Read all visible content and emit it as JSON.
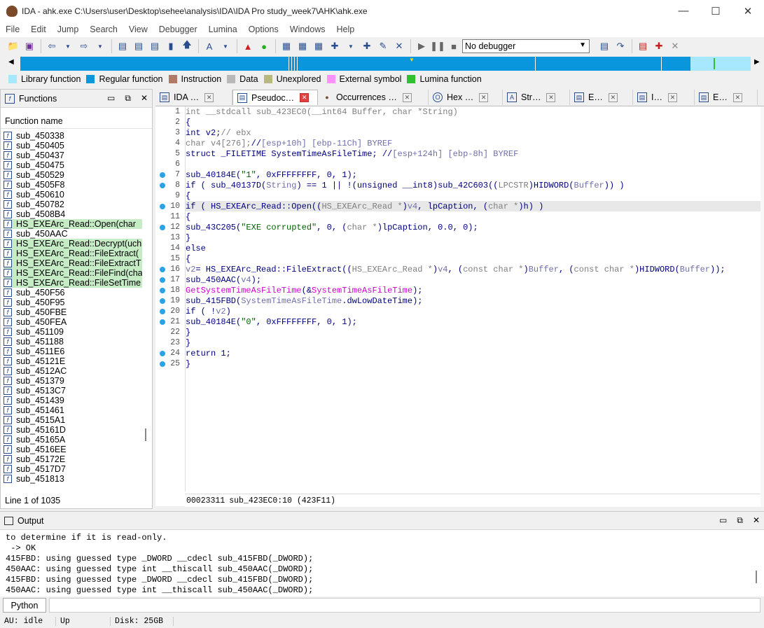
{
  "window": {
    "title": "IDA - ahk.exe C:\\Users\\user\\Desktop\\sehee\\analysis\\IDA\\IDA Pro study_week7\\AHK\\ahk.exe"
  },
  "menu": [
    "File",
    "Edit",
    "Jump",
    "Search",
    "View",
    "Debugger",
    "Lumina",
    "Options",
    "Windows",
    "Help"
  ],
  "toolbar": {
    "debugger_select": "No debugger"
  },
  "legend": [
    {
      "label": "Library function",
      "color": "#a8e8ff"
    },
    {
      "label": "Regular function",
      "color": "#0a96dc"
    },
    {
      "label": "Instruction",
      "color": "#b07a66"
    },
    {
      "label": "Data",
      "color": "#b8b8b8"
    },
    {
      "label": "Unexplored",
      "color": "#b8b880"
    },
    {
      "label": "External symbol",
      "color": "#ff90ff"
    },
    {
      "label": "Lumina function",
      "color": "#30c030"
    }
  ],
  "functions_panel": {
    "title": "Functions",
    "column": "Function name",
    "items": [
      {
        "name": "sub_450338",
        "lumina": false
      },
      {
        "name": "sub_450405",
        "lumina": false
      },
      {
        "name": "sub_450437",
        "lumina": false
      },
      {
        "name": "sub_450475",
        "lumina": false
      },
      {
        "name": "sub_450529",
        "lumina": false
      },
      {
        "name": "sub_4505F8",
        "lumina": false
      },
      {
        "name": "sub_450610",
        "lumina": false
      },
      {
        "name": "sub_450782",
        "lumina": false
      },
      {
        "name": "sub_4508B4",
        "lumina": false
      },
      {
        "name": "HS_EXEArc_Read::Open(char",
        "lumina": true
      },
      {
        "name": "sub_450AAC",
        "lumina": false
      },
      {
        "name": "HS_EXEArc_Read::Decrypt(uch",
        "lumina": true
      },
      {
        "name": "HS_EXEArc_Read::FileExtract(",
        "lumina": true
      },
      {
        "name": "HS_EXEArc_Read::FileExtractT",
        "lumina": true
      },
      {
        "name": "HS_EXEArc_Read::FileFind(cha",
        "lumina": true
      },
      {
        "name": "HS_EXEArc_Read::FileSetTime",
        "lumina": true
      },
      {
        "name": "sub_450F56",
        "lumina": false
      },
      {
        "name": "sub_450F95",
        "lumina": false
      },
      {
        "name": "sub_450FBE",
        "lumina": false
      },
      {
        "name": "sub_450FEA",
        "lumina": false
      },
      {
        "name": "sub_451109",
        "lumina": false
      },
      {
        "name": "sub_451188",
        "lumina": false
      },
      {
        "name": "sub_4511E6",
        "lumina": false
      },
      {
        "name": "sub_45121E",
        "lumina": false
      },
      {
        "name": "sub_4512AC",
        "lumina": false
      },
      {
        "name": "sub_451379",
        "lumina": false
      },
      {
        "name": "sub_4513C7",
        "lumina": false
      },
      {
        "name": "sub_451439",
        "lumina": false
      },
      {
        "name": "sub_451461",
        "lumina": false
      },
      {
        "name": "sub_4515A1",
        "lumina": false
      },
      {
        "name": "sub_45161D",
        "lumina": false
      },
      {
        "name": "sub_45165A",
        "lumina": false
      },
      {
        "name": "sub_4516EE",
        "lumina": false
      },
      {
        "name": "sub_45172E",
        "lumina": false
      },
      {
        "name": "sub_4517D7",
        "lumina": false
      },
      {
        "name": "sub_451813",
        "lumina": false
      }
    ],
    "status": "Line 1 of 1035"
  },
  "tabs": [
    {
      "label": "IDA …",
      "active": false
    },
    {
      "label": "Pseudoc…",
      "active": true
    },
    {
      "label": "Occurrences …",
      "active": false
    },
    {
      "label": "Hex …",
      "active": false
    },
    {
      "label": "Str…",
      "active": false
    },
    {
      "label": "E…",
      "active": false
    },
    {
      "label": "I…",
      "active": false
    },
    {
      "label": "E…",
      "active": false
    }
  ],
  "code": {
    "lines": [
      {
        "n": "1",
        "dot": false,
        "hl": false,
        "html": "<span class='g'>int __stdcall sub_423EC0(__int64 Buffer, char *String)</span>"
      },
      {
        "n": "2",
        "dot": false,
        "hl": false,
        "html": "<span class='k'>{</span>"
      },
      {
        "n": "3",
        "dot": false,
        "hl": false,
        "html": "  <span class='k'>int v2;</span> <span class='g'>// ebx</span>"
      },
      {
        "n": "4",
        "dot": false,
        "hl": false,
        "html": "  <span class='g'>char v4[276];</span> <span class='k'>//</span> <span class='vb'>[esp+10h] [ebp-11Ch] BYREF</span>"
      },
      {
        "n": "5",
        "dot": false,
        "hl": false,
        "html": "  <span class='k'>struct _FILETIME SystemTimeAsFileTime; //</span> <span class='vb'>[esp+124h] [ebp-8h] BYREF</span>"
      },
      {
        "n": "6",
        "dot": false,
        "hl": false,
        "html": ""
      },
      {
        "n": "7",
        "dot": true,
        "hl": false,
        "html": "  <span class='k'>sub_40184E(</span><span class='s'>\"1\"</span><span class='k'>, 0xFFFFFFFF, 0, 1);</span>"
      },
      {
        "n": "8",
        "dot": true,
        "hl": false,
        "html": "  <span class='k'>if ( sub_40137D(</span><span class='vb'>String</span><span class='k'>) == 1 || !(unsigned __int8)sub_42C603((</span><span class='g'>LPCSTR</span><span class='k'>)HIDWORD(</span><span class='vb'>Buffer</span><span class='k'>)) )</span>"
      },
      {
        "n": "9",
        "dot": false,
        "hl": false,
        "html": "  <span class='k'>{</span>"
      },
      {
        "n": "10",
        "dot": true,
        "hl": true,
        "html": "    <span class='k'>if ( HS_EXEArc_Read::Open((</span><span class='g'>HS_EXEArc_Read *</span><span class='k'>)</span><span class='vb'>v4</span><span class='k'>, lpCaption, (</span><span class='g'>char *</span><span class='k'>)h) )</span>"
      },
      {
        "n": "11",
        "dot": false,
        "hl": false,
        "html": "    <span class='k'>{</span>"
      },
      {
        "n": "12",
        "dot": true,
        "hl": false,
        "html": "      <span class='k'>sub_43C205(</span><span class='s'>\"EXE corrupted\"</span><span class='k'>, 0, (</span><span class='g'>char *</span><span class='k'>)lpCaption, 0.0, 0);</span>"
      },
      {
        "n": "13",
        "dot": false,
        "hl": false,
        "html": "    <span class='k'>}</span>"
      },
      {
        "n": "14",
        "dot": false,
        "hl": false,
        "html": "    <span class='k'>else</span>"
      },
      {
        "n": "15",
        "dot": false,
        "hl": false,
        "html": "    <span class='k'>{</span>"
      },
      {
        "n": "16",
        "dot": true,
        "hl": false,
        "html": "      <span class='vb'>v2</span> <span class='k'>= HS_EXEArc_Read::FileExtract((</span><span class='g'>HS_EXEArc_Read *</span><span class='k'>)</span><span class='vb'>v4</span><span class='k'>, (</span><span class='g'>const char *</span><span class='k'>)</span><span class='vb'>Buffer</span><span class='k'>, (</span><span class='g'>const char *</span><span class='k'>)HIDWORD(</span><span class='vb'>Buffer</span><span class='k'>));</span>"
      },
      {
        "n": "17",
        "dot": true,
        "hl": false,
        "html": "      <span class='k'>sub_450AAC(</span><span class='vb'>v4</span><span class='k'>);</span>"
      },
      {
        "n": "18",
        "dot": true,
        "hl": false,
        "html": "      <span class='ia'>GetSystemTimeAsFileTime</span><span class='k'>(&amp;</span><span class='ia'>SystemTimeAsFileTime</span><span class='k'>);</span>"
      },
      {
        "n": "19",
        "dot": true,
        "hl": false,
        "html": "      <span class='k'>sub_415FBD(</span><span class='vb'>SystemTimeAsFileTime</span><span class='k'>.dwLowDateTime);</span>"
      },
      {
        "n": "20",
        "dot": true,
        "hl": false,
        "html": "      <span class='k'>if ( !</span><span class='vb'>v2</span> <span class='k'>)</span>"
      },
      {
        "n": "21",
        "dot": true,
        "hl": false,
        "html": "        <span class='k'>sub_40184E(</span><span class='s'>\"0\"</span><span class='k'>, 0xFFFFFFFF, 0, 1);</span>"
      },
      {
        "n": "22",
        "dot": false,
        "hl": false,
        "html": "    <span class='k'>}</span>"
      },
      {
        "n": "23",
        "dot": false,
        "hl": false,
        "html": "  <span class='k'>}</span>"
      },
      {
        "n": "24",
        "dot": true,
        "hl": false,
        "html": "  <span class='k'>return 1;</span>"
      },
      {
        "n": "25",
        "dot": true,
        "hl": false,
        "html": "<span class='k'>}</span>"
      }
    ],
    "status_addr": "00023311",
    "status_loc": "sub_423EC0:10 (423F11)"
  },
  "output": {
    "title": "Output",
    "lines": [
      "to determine if it is read-only.",
      " -> OK",
      "415FBD: using guessed type _DWORD __cdecl sub_415FBD(_DWORD);",
      "450AAC: using guessed type int __thiscall sub_450AAC(_DWORD);",
      "415FBD: using guessed type _DWORD __cdecl sub_415FBD(_DWORD);",
      "450AAC: using guessed type int __thiscall sub_450AAC(_DWORD);"
    ],
    "python_button": "Python"
  },
  "status": {
    "au": "AU:  idle",
    "dir": "Up",
    "disk": "Disk: 25GB"
  }
}
